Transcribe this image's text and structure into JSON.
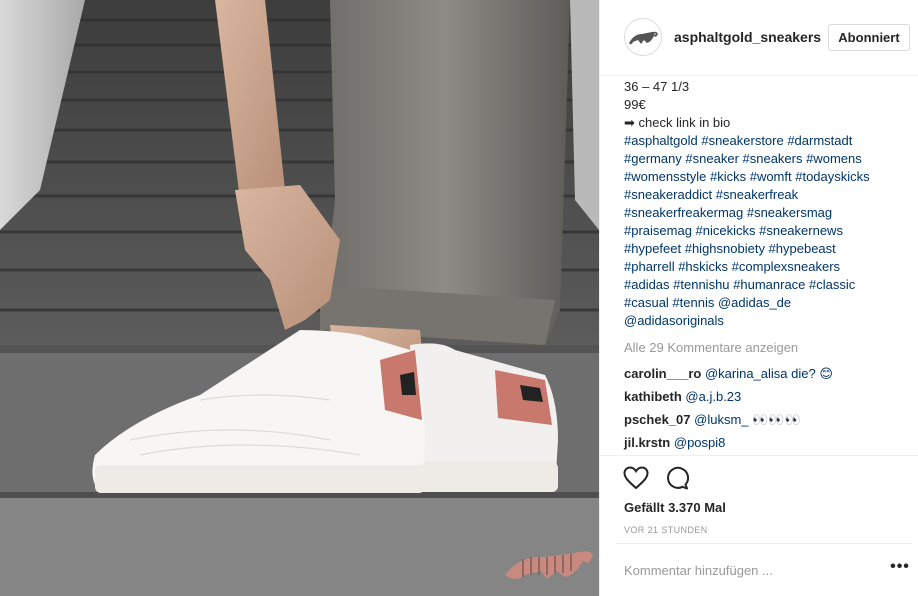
{
  "post": {
    "username": "asphaltgold_sneakers",
    "follow_label": "Abonniert",
    "caption_lines": [
      "36 – 47 1/3",
      "99€",
      "➡ check link in bio"
    ],
    "hashtag_lines": [
      "#asphaltgold #sneakerstore #darmstadt",
      "#germany #sneaker #sneakers #womens",
      "#womensstyle #kicks #womft #todayskicks",
      "#sneakeraddict #sneakerfreak",
      "#sneakerfreakermag #sneakersmag",
      "#praisemag #nicekicks #sneakernews",
      "#hypefeet #highsnobiety #hypebeast",
      "#pharrell #hskicks #complexsneakers",
      "#adidas #tennishu #humanrace #classic",
      "#casual #tennis @adidas_de",
      "@adidasoriginals"
    ],
    "load_more_label": "Alle 29 Kommentare anzeigen",
    "comments": [
      {
        "author": "carolin___ro",
        "text": "@karina_alisa die? 😊"
      },
      {
        "author": "kathibeth",
        "text": "@a.j.b.23"
      },
      {
        "author": "pschek_07",
        "text": "@luksm_ 👀👀👀"
      },
      {
        "author": "jil.krstn",
        "text": "@pospi8"
      }
    ],
    "likes_label": "Gefällt 3.370 Mal",
    "timestamp": "VOR 21 STUNDEN",
    "comment_placeholder": "Kommentar hinzufügen ...",
    "more_label": "•••"
  },
  "icons": {
    "like": "heart-icon",
    "comment": "comment-icon",
    "options": "more-icon",
    "avatar": "panther-logo",
    "watermark": "panther-logo"
  },
  "colors": {
    "link": "#003569",
    "muted": "#999999",
    "text": "#262626",
    "shoe_accent": "#c8786c"
  }
}
